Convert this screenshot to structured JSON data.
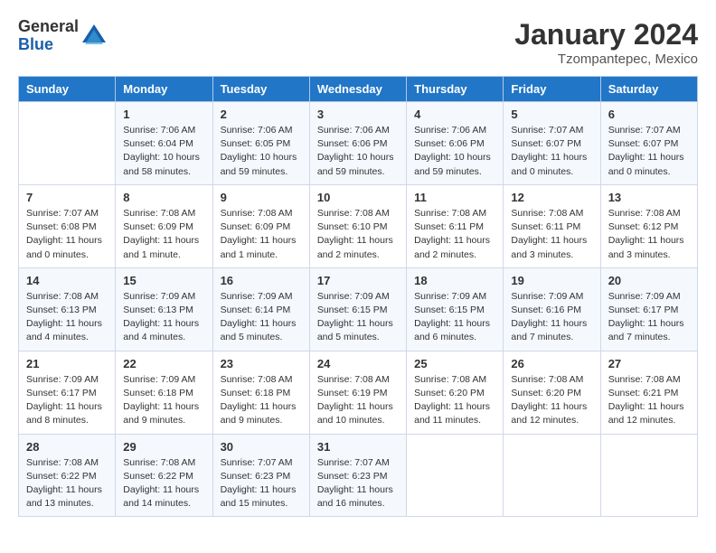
{
  "logo": {
    "general": "General",
    "blue": "Blue"
  },
  "title": "January 2024",
  "subtitle": "Tzompantepec, Mexico",
  "days_header": [
    "Sunday",
    "Monday",
    "Tuesday",
    "Wednesday",
    "Thursday",
    "Friday",
    "Saturday"
  ],
  "weeks": [
    [
      {
        "day": "",
        "info": ""
      },
      {
        "day": "1",
        "info": "Sunrise: 7:06 AM\nSunset: 6:04 PM\nDaylight: 10 hours\nand 58 minutes."
      },
      {
        "day": "2",
        "info": "Sunrise: 7:06 AM\nSunset: 6:05 PM\nDaylight: 10 hours\nand 59 minutes."
      },
      {
        "day": "3",
        "info": "Sunrise: 7:06 AM\nSunset: 6:06 PM\nDaylight: 10 hours\nand 59 minutes."
      },
      {
        "day": "4",
        "info": "Sunrise: 7:06 AM\nSunset: 6:06 PM\nDaylight: 10 hours\nand 59 minutes."
      },
      {
        "day": "5",
        "info": "Sunrise: 7:07 AM\nSunset: 6:07 PM\nDaylight: 11 hours\nand 0 minutes."
      },
      {
        "day": "6",
        "info": "Sunrise: 7:07 AM\nSunset: 6:07 PM\nDaylight: 11 hours\nand 0 minutes."
      }
    ],
    [
      {
        "day": "7",
        "info": "Sunrise: 7:07 AM\nSunset: 6:08 PM\nDaylight: 11 hours\nand 0 minutes."
      },
      {
        "day": "8",
        "info": "Sunrise: 7:08 AM\nSunset: 6:09 PM\nDaylight: 11 hours\nand 1 minute."
      },
      {
        "day": "9",
        "info": "Sunrise: 7:08 AM\nSunset: 6:09 PM\nDaylight: 11 hours\nand 1 minute."
      },
      {
        "day": "10",
        "info": "Sunrise: 7:08 AM\nSunset: 6:10 PM\nDaylight: 11 hours\nand 2 minutes."
      },
      {
        "day": "11",
        "info": "Sunrise: 7:08 AM\nSunset: 6:11 PM\nDaylight: 11 hours\nand 2 minutes."
      },
      {
        "day": "12",
        "info": "Sunrise: 7:08 AM\nSunset: 6:11 PM\nDaylight: 11 hours\nand 3 minutes."
      },
      {
        "day": "13",
        "info": "Sunrise: 7:08 AM\nSunset: 6:12 PM\nDaylight: 11 hours\nand 3 minutes."
      }
    ],
    [
      {
        "day": "14",
        "info": "Sunrise: 7:08 AM\nSunset: 6:13 PM\nDaylight: 11 hours\nand 4 minutes."
      },
      {
        "day": "15",
        "info": "Sunrise: 7:09 AM\nSunset: 6:13 PM\nDaylight: 11 hours\nand 4 minutes."
      },
      {
        "day": "16",
        "info": "Sunrise: 7:09 AM\nSunset: 6:14 PM\nDaylight: 11 hours\nand 5 minutes."
      },
      {
        "day": "17",
        "info": "Sunrise: 7:09 AM\nSunset: 6:15 PM\nDaylight: 11 hours\nand 5 minutes."
      },
      {
        "day": "18",
        "info": "Sunrise: 7:09 AM\nSunset: 6:15 PM\nDaylight: 11 hours\nand 6 minutes."
      },
      {
        "day": "19",
        "info": "Sunrise: 7:09 AM\nSunset: 6:16 PM\nDaylight: 11 hours\nand 7 minutes."
      },
      {
        "day": "20",
        "info": "Sunrise: 7:09 AM\nSunset: 6:17 PM\nDaylight: 11 hours\nand 7 minutes."
      }
    ],
    [
      {
        "day": "21",
        "info": "Sunrise: 7:09 AM\nSunset: 6:17 PM\nDaylight: 11 hours\nand 8 minutes."
      },
      {
        "day": "22",
        "info": "Sunrise: 7:09 AM\nSunset: 6:18 PM\nDaylight: 11 hours\nand 9 minutes."
      },
      {
        "day": "23",
        "info": "Sunrise: 7:08 AM\nSunset: 6:18 PM\nDaylight: 11 hours\nand 9 minutes."
      },
      {
        "day": "24",
        "info": "Sunrise: 7:08 AM\nSunset: 6:19 PM\nDaylight: 11 hours\nand 10 minutes."
      },
      {
        "day": "25",
        "info": "Sunrise: 7:08 AM\nSunset: 6:20 PM\nDaylight: 11 hours\nand 11 minutes."
      },
      {
        "day": "26",
        "info": "Sunrise: 7:08 AM\nSunset: 6:20 PM\nDaylight: 11 hours\nand 12 minutes."
      },
      {
        "day": "27",
        "info": "Sunrise: 7:08 AM\nSunset: 6:21 PM\nDaylight: 11 hours\nand 12 minutes."
      }
    ],
    [
      {
        "day": "28",
        "info": "Sunrise: 7:08 AM\nSunset: 6:22 PM\nDaylight: 11 hours\nand 13 minutes."
      },
      {
        "day": "29",
        "info": "Sunrise: 7:08 AM\nSunset: 6:22 PM\nDaylight: 11 hours\nand 14 minutes."
      },
      {
        "day": "30",
        "info": "Sunrise: 7:07 AM\nSunset: 6:23 PM\nDaylight: 11 hours\nand 15 minutes."
      },
      {
        "day": "31",
        "info": "Sunrise: 7:07 AM\nSunset: 6:23 PM\nDaylight: 11 hours\nand 16 minutes."
      },
      {
        "day": "",
        "info": ""
      },
      {
        "day": "",
        "info": ""
      },
      {
        "day": "",
        "info": ""
      }
    ]
  ]
}
